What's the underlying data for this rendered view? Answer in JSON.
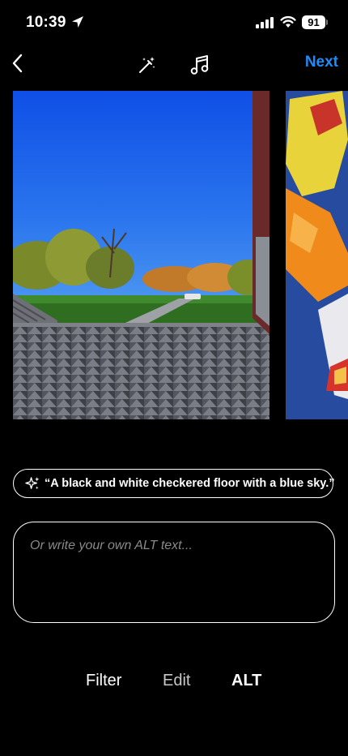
{
  "status_bar": {
    "time": "10:39",
    "battery": "91",
    "icons": [
      "location-arrow-icon",
      "cellular-signal-icon",
      "wifi-icon",
      "battery-icon"
    ]
  },
  "top_bar": {
    "back_icon": "chevron-left-icon",
    "magic_icon": "magic-wand-icon",
    "music_icon": "music-note-icon",
    "next_label": "Next",
    "accent_color": "#1d8cf8"
  },
  "photos": [
    {
      "description_visible": false
    },
    {
      "description_visible": false
    }
  ],
  "suggestion": {
    "icon": "sparkles-icon",
    "text": "“A black and white checkered floor with a blue sky.”"
  },
  "alt_input": {
    "placeholder": "Or write your own ALT text...",
    "value": ""
  },
  "tabs": [
    {
      "label": "Filter"
    },
    {
      "label": "Edit"
    },
    {
      "label": "ALT",
      "selected": true
    }
  ]
}
